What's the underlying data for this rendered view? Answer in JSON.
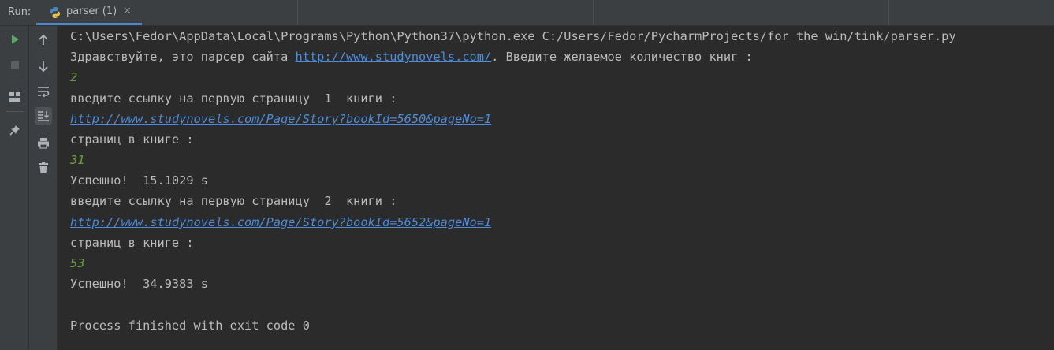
{
  "header": {
    "run_label": "Run:",
    "tab_label": "parser (1)",
    "tab_close": "✕"
  },
  "toolbar": {
    "left": [
      "run-icon",
      "stop-icon",
      "layout-icon",
      "pin-icon"
    ],
    "right": [
      "up-arrow-icon",
      "down-arrow-icon",
      "soft-wrap-icon",
      "scroll-to-end-icon",
      "print-icon",
      "trash-icon"
    ]
  },
  "console": {
    "command": "C:\\Users\\Fedor\\AppData\\Local\\Programs\\Python\\Python37\\python.exe C:/Users/Fedor/PycharmProjects/for_the_win/tink/parser.py",
    "greeting_prefix": "Здравствуйте, это парсер сайта ",
    "greeting_link": "http://www.studynovels.com/",
    "greeting_suffix": ". Введите желаемое количество книг :",
    "input_books": "2",
    "prompt_link_1": "введите ссылку на первую страницу  1  книги :",
    "link_1": "http://www.studynovels.com/Page/Story?bookId=5650&pageNo=1",
    "pages_prompt_1": "страниц в книге :",
    "pages_1": "31",
    "success_1": "Успешно!  15.1029 s",
    "prompt_link_2": "введите ссылку на первую страницу  2  книги :",
    "link_2": "http://www.studynovels.com/Page/Story?bookId=5652&pageNo=1",
    "pages_prompt_2": "страниц в книге :",
    "pages_2": "53",
    "success_2": "Успешно!  34.9383 s",
    "finished": "Process finished with exit code 0"
  },
  "colors": {
    "background": "#2b2b2b",
    "panel": "#3c3f41",
    "text": "#bbbbbb",
    "link": "#4e8bd8",
    "user_input": "#6a9d3a",
    "run_green": "#59a869",
    "tab_accent": "#4a88c7"
  }
}
